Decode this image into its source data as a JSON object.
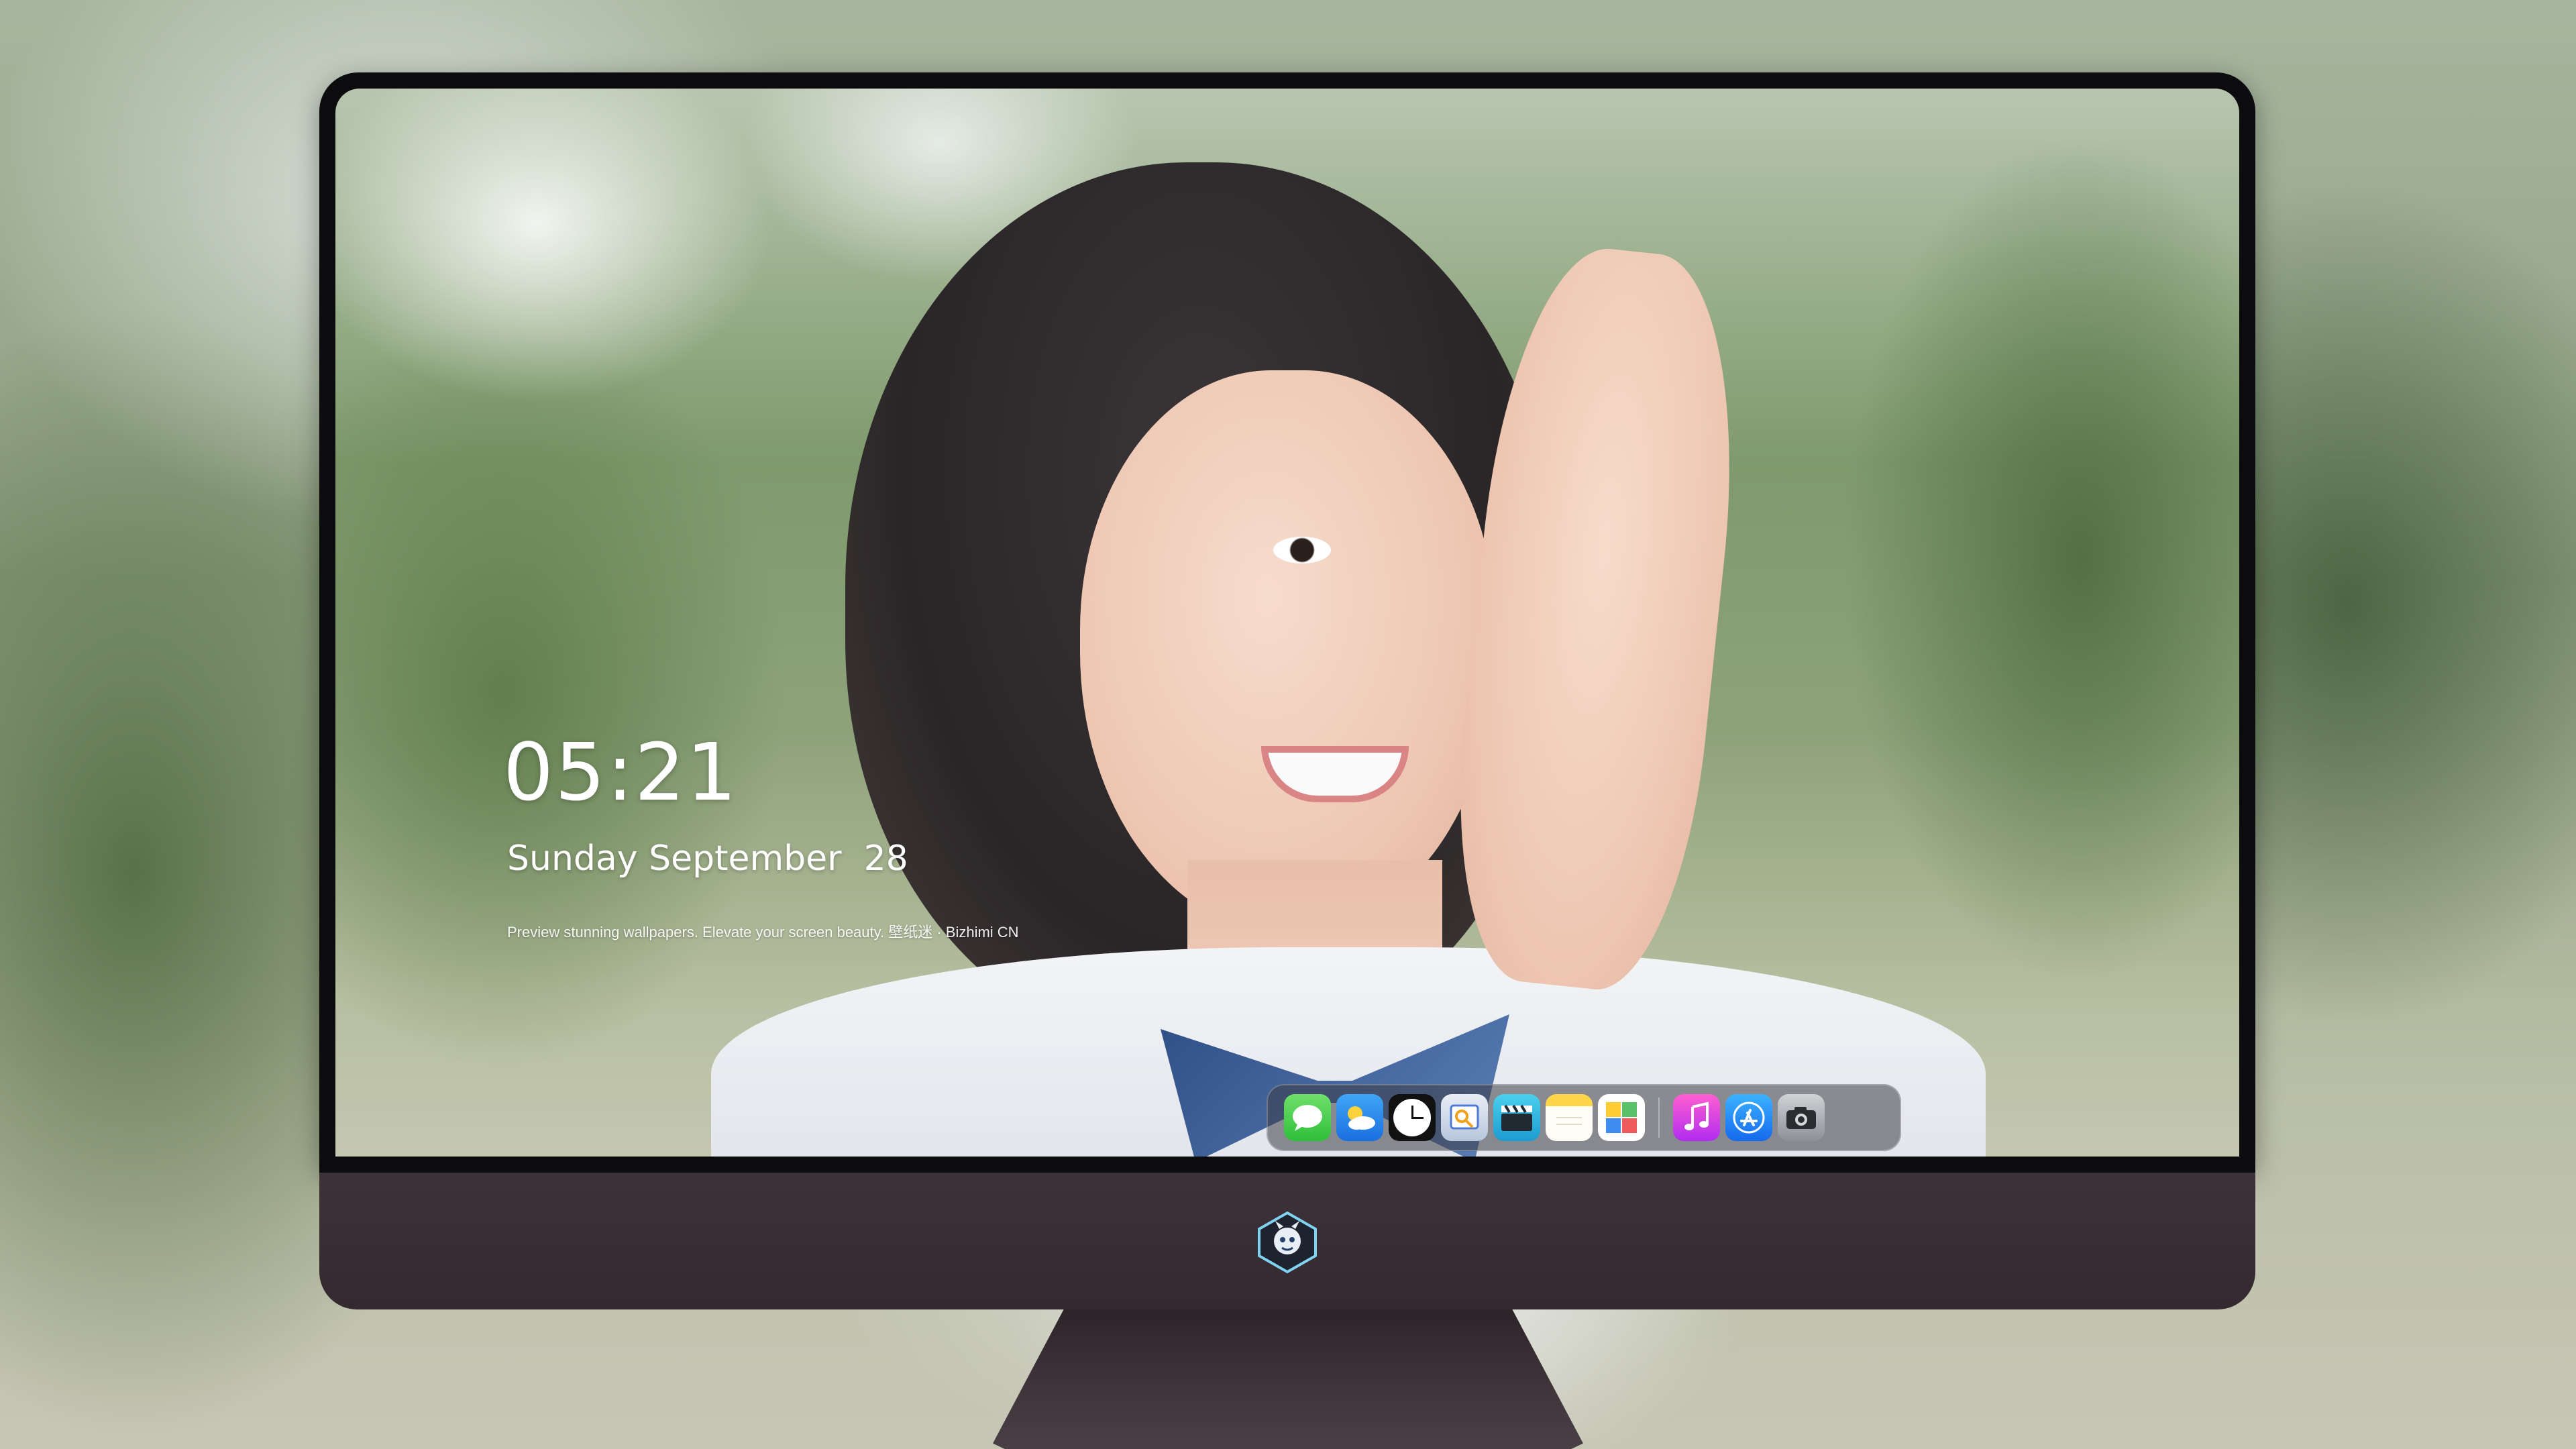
{
  "lockscreen": {
    "time": "05:21",
    "date": "Sunday September  28",
    "tagline": "Preview stunning wallpapers. Elevate your screen beauty. 壁纸迷 · Bizhimi CN"
  },
  "dock": {
    "apps": [
      {
        "name": "messages",
        "icon": "messages-icon"
      },
      {
        "name": "weather",
        "icon": "weather-icon"
      },
      {
        "name": "clock",
        "icon": "clock-icon"
      },
      {
        "name": "preview",
        "icon": "preview-icon"
      },
      {
        "name": "clips",
        "icon": "clapperboard-icon"
      },
      {
        "name": "notes",
        "icon": "notes-icon"
      },
      {
        "name": "photos",
        "icon": "photos-icon"
      },
      {
        "name": "music",
        "icon": "music-icon"
      },
      {
        "name": "app-store",
        "icon": "app-store-icon"
      },
      {
        "name": "camera",
        "icon": "camera-icon"
      }
    ]
  },
  "colors": {
    "bezel": "#0c0c0e",
    "chin": "#3d3239",
    "text": "#ffffff"
  }
}
